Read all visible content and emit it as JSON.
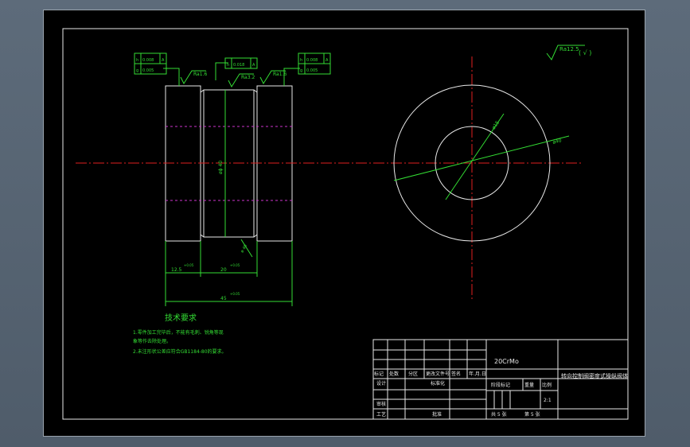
{
  "drawing": {
    "roughness_symbol": "Ra12.5",
    "roughness_symbol_paren": "( √ )",
    "tol_left": [
      [
        "h",
        "0.008",
        "A"
      ],
      [
        "g",
        "0.005",
        ""
      ]
    ],
    "tol_center": [
      "h",
      "0.018",
      "A"
    ],
    "tol_right": [
      [
        "h",
        "0.008",
        "A"
      ],
      [
        "g",
        "0.005",
        ""
      ]
    ],
    "surf_left": "Ra1.6",
    "surf_center": "Ra3.2",
    "surf_right": "Ra1.6",
    "dim_left": "12.5",
    "dim_left_tol": "+0.05",
    "dim_mid": "20",
    "dim_mid_tol": "+0.05",
    "dim_total": "45",
    "dim_total_tol": "+0.05",
    "dim_vertical": "øϕ 40",
    "dim_chamfer": "ø 40",
    "dim_circle_small": "ø15",
    "dim_circle_large": "ø40"
  },
  "notes": {
    "title": "技术要求",
    "line1": "1.零件加工完毕后，不能有毛刺、锐角等现",
    "line2": "  象等作去除处理。",
    "line3": "2.未注形状公差应符合GB1184-80的要求。"
  },
  "title_block": {
    "material": "20CrMo",
    "drawing_name": "转向控制阀密度式操纵阀体",
    "h_mark": "标记",
    "h_count": "处数",
    "h_zone": "分区",
    "h_doc": "更改文件号",
    "h_sign": "签名",
    "h_date": "年.月.日",
    "design": "设计",
    "standard": "标准化",
    "stage": "阶段标记",
    "weight": "重量",
    "scale": "比例",
    "scale_val": "2:1",
    "check": "审核",
    "process": "工艺",
    "approve": "批准",
    "sheets_total": "共 5 张",
    "sheet_no": "第 5 张"
  }
}
